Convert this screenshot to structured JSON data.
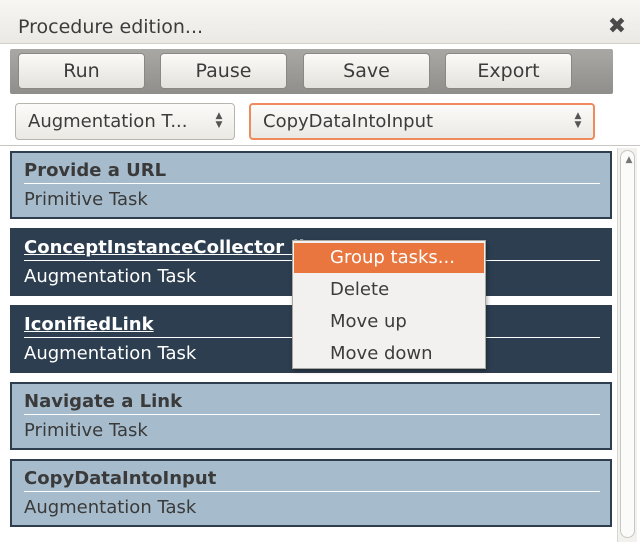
{
  "window": {
    "title": "Procedure edition...",
    "close_icon": "✖"
  },
  "toolbar": {
    "run_label": "Run",
    "pause_label": "Pause",
    "save_label": "Save",
    "export_label": "Export"
  },
  "selectors": {
    "category_value": "Augmentation T...",
    "task_value": "CopyDataIntoInput"
  },
  "tasks": [
    {
      "name": "Provide a URL",
      "type": "Primitive Task",
      "selected": false
    },
    {
      "name": "ConceptInstanceCollector (i",
      "type": "Augmentation Task",
      "selected": true
    },
    {
      "name": "IconifiedLink",
      "type": "Augmentation Task",
      "selected": true
    },
    {
      "name": "Navigate a Link",
      "type": "Primitive Task",
      "selected": false
    },
    {
      "name": "CopyDataIntoInput",
      "type": "Augmentation Task",
      "selected": false
    }
  ],
  "context_menu": {
    "items": [
      "Group tasks...",
      "Delete",
      "Move up",
      "Move down"
    ],
    "highlighted_index": 0
  },
  "colors": {
    "accent": "#e9763f",
    "selected_task": "#2c3e50",
    "unselected_task": "#a6bccd"
  }
}
